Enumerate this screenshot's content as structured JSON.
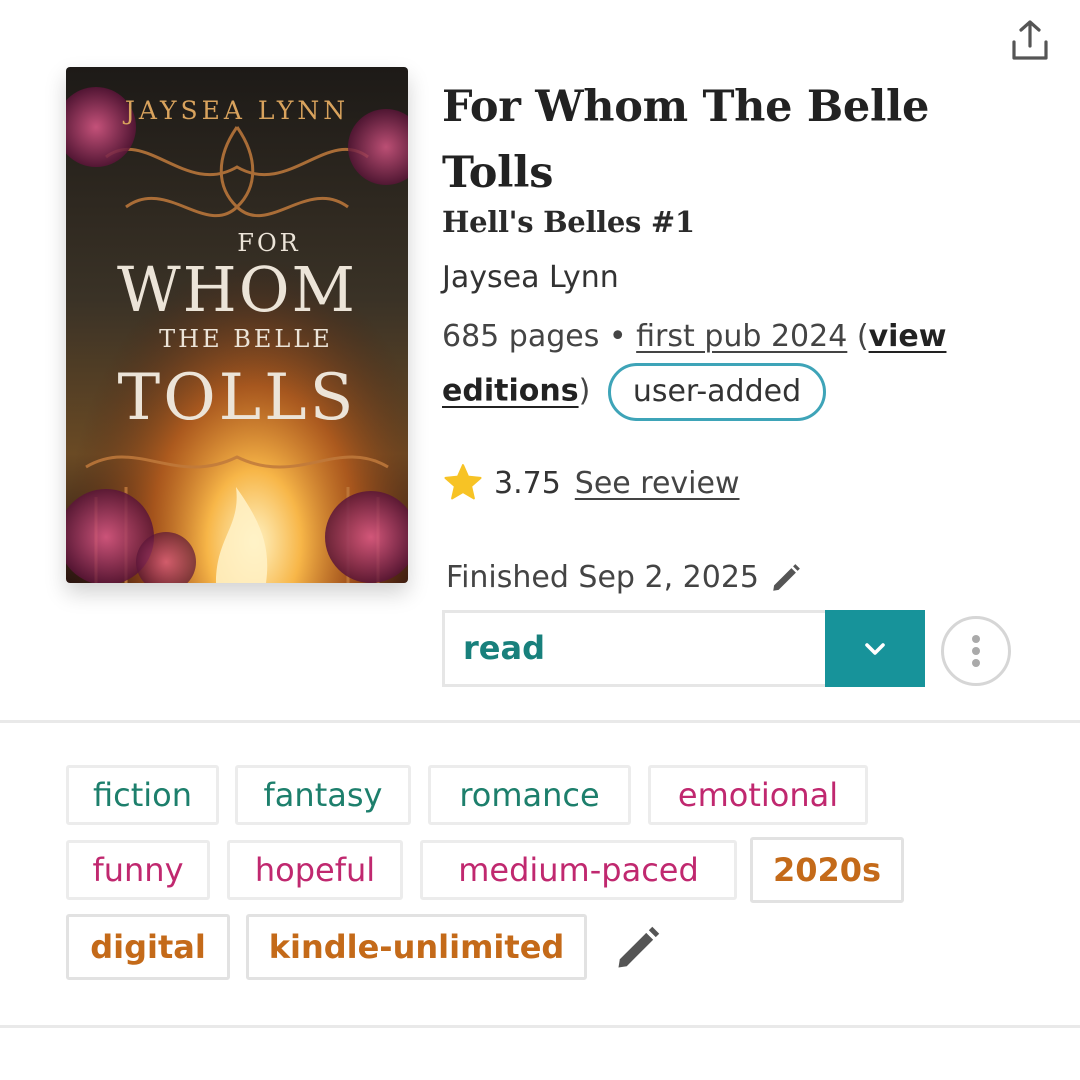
{
  "header": {
    "share_icon": "share-icon"
  },
  "book": {
    "cover_author": "JAYSEA LYNN",
    "cover_title_line1": "FOR",
    "cover_title_line2": "WHOM",
    "cover_title_line3": "THE BELLE",
    "cover_title_line4": "TOLLS",
    "title": "For Whom The Belle Tolls",
    "series": "Hell's Belles #1",
    "author": "Jaysea Lynn",
    "pages": "685 pages",
    "separator": "•",
    "first_pub": "first pub 2024",
    "view_editions": "view editions",
    "user_added": "user-added"
  },
  "rating": {
    "value": "3.75",
    "see_review": "See review",
    "icon": "star-icon",
    "color": "#f7c325"
  },
  "reading": {
    "finished": "Finished Sep 2, 2025",
    "status": "read",
    "accent": "#17939a"
  },
  "tags": [
    {
      "label": "fiction",
      "color": "teal"
    },
    {
      "label": "fantasy",
      "color": "teal"
    },
    {
      "label": "romance",
      "color": "teal"
    },
    {
      "label": "emotional",
      "color": "pink"
    },
    {
      "label": "funny",
      "color": "pink"
    },
    {
      "label": "hopeful",
      "color": "pink"
    },
    {
      "label": "medium-paced",
      "color": "pink"
    },
    {
      "label": "2020s",
      "color": "orange"
    },
    {
      "label": "digital",
      "color": "orange"
    },
    {
      "label": "kindle-unlimited",
      "color": "orange"
    }
  ]
}
